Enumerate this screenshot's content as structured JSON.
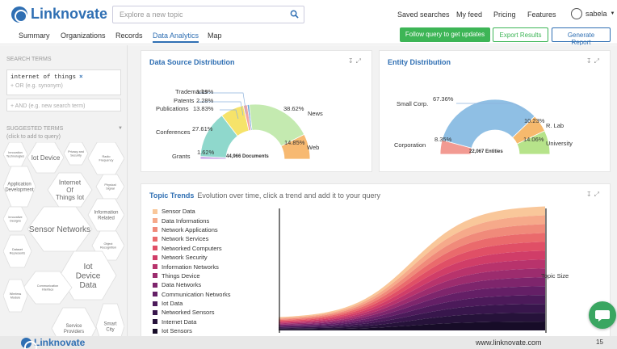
{
  "brand": {
    "name": "Linknovate"
  },
  "search": {
    "placeholder": "Explore a new topic"
  },
  "top_links": [
    "Saved searches",
    "My feed",
    "Pricing",
    "Features"
  ],
  "user": {
    "name": "sabela"
  },
  "tabs": [
    {
      "label": "Summary",
      "active": false
    },
    {
      "label": "Organizations",
      "active": false
    },
    {
      "label": "Records",
      "active": false
    },
    {
      "label": "Data Analytics",
      "active": true
    },
    {
      "label": "Map",
      "active": false
    }
  ],
  "actions": {
    "follow": "Follow query to get updates",
    "export": "Export Results",
    "report": "Generate Report"
  },
  "sidebar": {
    "search_terms_title": "Search Terms",
    "term": "internet of things",
    "term_remove": "×",
    "or_placeholder": "+ OR (e.g. synonym)",
    "and_placeholder": "+ AND (e.g. new search term)",
    "suggested_title": "Suggested Terms",
    "suggested_subtitle": "(click to add to query)",
    "suggested_terms": [
      {
        "label": "Innovation Technologies",
        "size": "xs"
      },
      {
        "label": "Iot Device",
        "size": "md"
      },
      {
        "label": "Privacy and Security",
        "size": "xs"
      },
      {
        "label": "Radio Frequency",
        "size": "xs"
      },
      {
        "label": "Application Development",
        "size": "sm"
      },
      {
        "label": "Internet Of Things Iot",
        "size": "md"
      },
      {
        "label": "Physical Signal",
        "size": "xs"
      },
      {
        "label": "Information Related",
        "size": "sm"
      },
      {
        "label": "Innovative Designs",
        "size": "xs"
      },
      {
        "label": "Sensor Networks",
        "size": "lg"
      },
      {
        "label": "Object Recognition",
        "size": "xs"
      },
      {
        "label": "Dataset Represents",
        "size": "xs"
      },
      {
        "label": "Iot Device Data",
        "size": "lg"
      },
      {
        "label": "Communication Interface",
        "size": "xs"
      },
      {
        "label": "Wireless Module",
        "size": "xs"
      },
      {
        "label": "Service Providers",
        "size": "sm"
      },
      {
        "label": "Smart City",
        "size": "sm"
      }
    ]
  },
  "data_source": {
    "title": "Data Source Distribution",
    "total": "44,966 Documents",
    "slices": [
      {
        "label": "Grants",
        "pct": "1.62%",
        "value": 1.62,
        "color": "#c9a6e8"
      },
      {
        "label": "Conferences",
        "pct": "27.61%",
        "value": 27.61,
        "color": "#8fd8cc"
      },
      {
        "label": "Publications",
        "pct": "13.83%",
        "value": 13.83,
        "color": "#f6e36a"
      },
      {
        "label": "Patents",
        "pct": "2.28%",
        "value": 2.28,
        "color": "#f4a3a3"
      },
      {
        "label": "Trademarks",
        "pct": "1.19%",
        "value": 1.19,
        "color": "#6aa2d8"
      },
      {
        "label": "News",
        "pct": "38.62%",
        "value": 38.62,
        "color": "#c4eab0"
      },
      {
        "label": "Web",
        "pct": "14.85%",
        "value": 14.85,
        "color": "#f7b971"
      }
    ]
  },
  "entity": {
    "title": "Entity Distribution",
    "total": "22,067 Entities",
    "slices": [
      {
        "label": "Corporation",
        "pct": "8.35%",
        "value": 8.35,
        "color": "#f29a92"
      },
      {
        "label": "Small Corp.",
        "pct": "67.36%",
        "value": 67.36,
        "color": "#8fbfe4"
      },
      {
        "label": "R. Lab",
        "pct": "10.23%",
        "value": 10.23,
        "color": "#f6b96d"
      },
      {
        "label": "University",
        "pct": "14.06%",
        "value": 14.06,
        "color": "#b6e38a"
      }
    ]
  },
  "topic_trends": {
    "title": "Topic Trends",
    "subtitle": "Evolution over time, click a trend and add it to your query",
    "axis_label": "Topic Size",
    "series": [
      {
        "name": "Sensor Data",
        "color": "#f9c79a"
      },
      {
        "name": "Data Informations",
        "color": "#f6a98a"
      },
      {
        "name": "Network Applications",
        "color": "#f08a7a"
      },
      {
        "name": "Network Services",
        "color": "#ea6a6c"
      },
      {
        "name": "Networked Computers",
        "color": "#e04f66"
      },
      {
        "name": "Network Security",
        "color": "#d03d68"
      },
      {
        "name": "Information Networks",
        "color": "#b8336c"
      },
      {
        "name": "Things Device",
        "color": "#9c2c6e"
      },
      {
        "name": "Data Networks",
        "color": "#7e256c"
      },
      {
        "name": "Communication Networks",
        "color": "#641f66"
      },
      {
        "name": "Iot Data",
        "color": "#4c1a5a"
      },
      {
        "name": "Networked Sensors",
        "color": "#38164c"
      },
      {
        "name": "Internet Data",
        "color": "#26123a"
      },
      {
        "name": "Iot Sensors",
        "color": "#170c28"
      }
    ]
  },
  "footer": {
    "brand": "Linknovate",
    "url": "www.linknovate.com",
    "page": "15"
  }
}
